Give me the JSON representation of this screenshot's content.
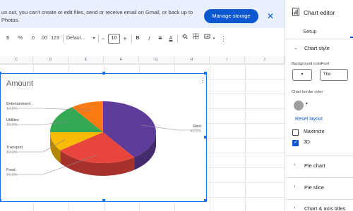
{
  "banner": {
    "text": "un out, you can't create or edit files, send or receive email on Gmail, or back up to\nPhotos.",
    "button": "Manage storage",
    "close_icon": "close-icon"
  },
  "toolbar": {
    "dollar": "$",
    "percent": "%",
    "dec_decrease": ".0",
    "dec_increase": ".00",
    "number_format": "123",
    "font_family": "Defaul...",
    "minus": "−",
    "font_size": "10",
    "plus": "+",
    "bold": "B",
    "italic": "I",
    "strike": "S",
    "text_color": "A",
    "fill_icon": "paint-bucket-icon",
    "borders_icon": "borders-icon",
    "merge_icon": "merge-icon",
    "more": "⋮"
  },
  "sheet": {
    "columns": [
      "C",
      "D",
      "E",
      "F",
      "G",
      "H",
      "I",
      "J"
    ]
  },
  "chart": {
    "menu": "⋮",
    "labels": {
      "entertainment": "Entertainment",
      "entertainment_pct": "10.0%",
      "utilities": "Utilities",
      "utilities_pct": "15.0%",
      "transport": "Transport",
      "transport_pct": "10.0%",
      "food": "Food",
      "food_pct": "25.0%",
      "rent": "Rent",
      "rent_pct": "40.0%"
    }
  },
  "chart_data": {
    "type": "pie",
    "title": "Amount",
    "is_3d": true,
    "slices": [
      {
        "label": "Rent",
        "value": 40.0,
        "color": "#5e3c99"
      },
      {
        "label": "Food",
        "value": 25.0,
        "color": "#e8453c"
      },
      {
        "label": "Transport",
        "value": 10.0,
        "color": "#f9bb05"
      },
      {
        "label": "Utilities",
        "value": 15.0,
        "color": "#34a853"
      },
      {
        "label": "Entertainment",
        "value": 10.0,
        "color": "#fa7a14"
      }
    ]
  },
  "panel": {
    "title": "Chart editor",
    "tab_setup": "Setup",
    "section_chart_style": "Chart style",
    "background_color_label": "Background color",
    "font_label": "Font",
    "font_value": "The",
    "border_color_label": "Chart border color",
    "reset_layout": "Reset layout",
    "maximize_label": "Maximize",
    "maximize_checked": false,
    "three_d_label": "3D",
    "three_d_checked": true,
    "pie_chart": "Pie chart",
    "pie_slice": "Pie slice",
    "chart_axis_titles": "Chart & axis titles",
    "accent_color": "#0b57d0",
    "border_swatch_color": "#9e9e9e"
  }
}
